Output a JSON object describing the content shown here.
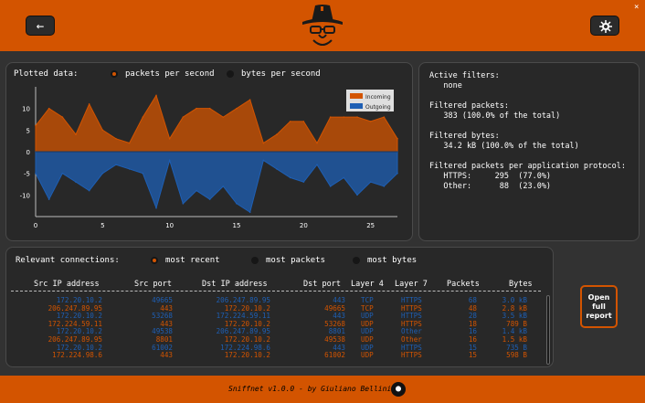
{
  "header": {
    "back_icon": "arrow-left-icon",
    "settings_icon": "gear-icon",
    "close_glyph": "×",
    "brand_color": "#d35400"
  },
  "chart": {
    "title": "Plotted data:",
    "options": [
      {
        "label": "packets per second",
        "selected": true
      },
      {
        "label": "bytes per second",
        "selected": false
      }
    ],
    "legend": [
      "Incoming",
      "Outgoing"
    ]
  },
  "chart_data": {
    "type": "area",
    "x": [
      0,
      1,
      2,
      3,
      4,
      5,
      6,
      7,
      8,
      9,
      10,
      11,
      12,
      13,
      14,
      15,
      16,
      17,
      18,
      19,
      20,
      21,
      22,
      23,
      24,
      25,
      26,
      27
    ],
    "series": [
      {
        "name": "Incoming",
        "color": "#d35400",
        "values": [
          6,
          10,
          8,
          4,
          11,
          5,
          3,
          2,
          8,
          13,
          3,
          8,
          10,
          10,
          8,
          10,
          12,
          2,
          4,
          7,
          7,
          2,
          8,
          8,
          8,
          7,
          8,
          3
        ]
      },
      {
        "name": "Outgoing",
        "color": "#1e5fb4",
        "values": [
          -5,
          -11,
          -5,
          -7,
          -9,
          -5,
          -3,
          -4,
          -5,
          -13,
          -2,
          -12,
          -9,
          -11,
          -8,
          -12,
          -14,
          -2,
          -4,
          -6,
          -7,
          -3,
          -8,
          -6,
          -10,
          -7,
          -8,
          -5
        ]
      }
    ],
    "x_ticks": [
      0,
      5,
      10,
      15,
      20,
      25
    ],
    "y_ticks": [
      10,
      5,
      0,
      -5,
      -10
    ],
    "xlim": [
      0,
      27
    ],
    "ylim": [
      -15,
      15
    ],
    "grid": false,
    "legend_position": "top-right"
  },
  "filters": {
    "text": "Active filters:\n   none\n\nFiltered packets:\n   383 (100.0% of the total)\n\nFiltered bytes:\n   34.2 kB (100.0% of the total)\n\nFiltered packets per application protocol:\n   HTTPS:     295  (77.0%)\n   Other:      88  (23.0%)"
  },
  "connections": {
    "title": "Relevant connections:",
    "options": [
      {
        "label": "most recent",
        "selected": true
      },
      {
        "label": "most packets",
        "selected": false
      },
      {
        "label": "most bytes",
        "selected": false
      }
    ],
    "headers": [
      "Src IP address",
      "Src port",
      "Dst IP address",
      "Dst port",
      "Layer 4",
      "Layer 7",
      "Packets",
      "Bytes"
    ],
    "rows": [
      {
        "src": "172.20.10.2",
        "sport": "49665",
        "dst": "206.247.89.95",
        "dport": "443",
        "l4": "TCP",
        "l7": "HTTPS",
        "pk": "68",
        "by": "3.0 kB",
        "color": "#1e5fb4"
      },
      {
        "src": "206.247.89.95",
        "sport": "443",
        "dst": "172.20.10.2",
        "dport": "49665",
        "l4": "TCP",
        "l7": "HTTPS",
        "pk": "48",
        "by": "2.8 kB",
        "color": "#d35400"
      },
      {
        "src": "172.20.10.2",
        "sport": "53268",
        "dst": "172.224.59.11",
        "dport": "443",
        "l4": "UDP",
        "l7": "HTTPS",
        "pk": "28",
        "by": "3.5 kB",
        "color": "#1e5fb4"
      },
      {
        "src": "172.224.59.11",
        "sport": "443",
        "dst": "172.20.10.2",
        "dport": "53268",
        "l4": "UDP",
        "l7": "HTTPS",
        "pk": "18",
        "by": "789 B",
        "color": "#d35400"
      },
      {
        "src": "172.20.10.2",
        "sport": "49538",
        "dst": "206.247.89.95",
        "dport": "8801",
        "l4": "UDP",
        "l7": "Other",
        "pk": "16",
        "by": "1.4 kB",
        "color": "#1e5fb4"
      },
      {
        "src": "206.247.89.95",
        "sport": "8801",
        "dst": "172.20.10.2",
        "dport": "49538",
        "l4": "UDP",
        "l7": "Other",
        "pk": "16",
        "by": "1.5 kB",
        "color": "#d35400"
      },
      {
        "src": "172.20.10.2",
        "sport": "61002",
        "dst": "172.224.98.6",
        "dport": "443",
        "l4": "UDP",
        "l7": "HTTPS",
        "pk": "15",
        "by": "735 B",
        "color": "#1e5fb4"
      },
      {
        "src": "172.224.98.6",
        "sport": "443",
        "dst": "172.20.10.2",
        "dport": "61002",
        "l4": "UDP",
        "l7": "HTTPS",
        "pk": "15",
        "by": "598 B",
        "color": "#d35400"
      }
    ]
  },
  "report_button": {
    "line1": "Open",
    "line2": "full",
    "line3": "report"
  },
  "footer": {
    "text": "Sniffnet v1.0.0 - by Giuliano Bellini",
    "icon": "github-icon"
  }
}
